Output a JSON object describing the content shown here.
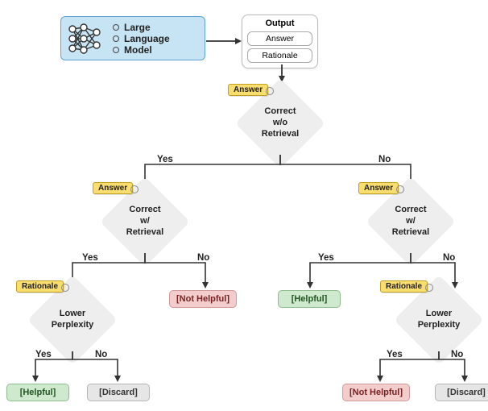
{
  "llm": {
    "line1": "Large",
    "line2": "Language",
    "line3": "Model"
  },
  "output": {
    "title": "Output",
    "pill1": "Answer",
    "pill2": "Rationale"
  },
  "tags": {
    "answer": "Answer",
    "rationale": "Rationale"
  },
  "nodes": {
    "root": {
      "l1": "Correct",
      "l2": "w/o",
      "l3": "Retrieval"
    },
    "leftA": {
      "l1": "Correct",
      "l2": "w/",
      "l3": "Retrieval"
    },
    "rightA": {
      "l1": "Correct",
      "l2": "w/",
      "l3": "Retrieval"
    },
    "leftB": {
      "l1": "Lower",
      "l2": "Perplexity"
    },
    "rightB": {
      "l1": "Lower",
      "l2": "Perplexity"
    }
  },
  "edges": {
    "yes": "Yes",
    "no": "No"
  },
  "leaves": {
    "helpful": "[Helpful]",
    "notHelpful": "[Not Helpful]",
    "discard": "[Discard]"
  }
}
